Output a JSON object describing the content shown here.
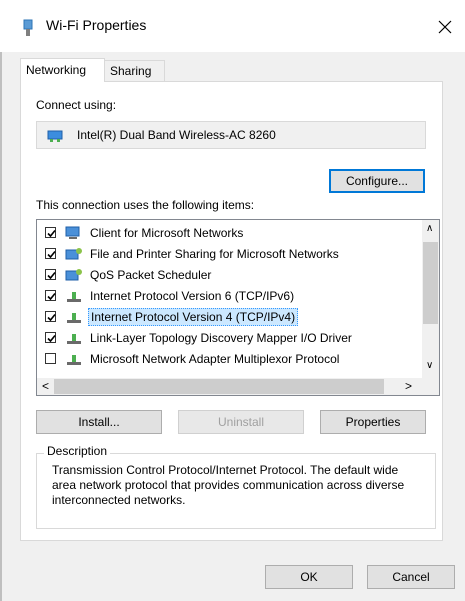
{
  "window": {
    "title": "Wi-Fi Properties",
    "close_glyph": "✕"
  },
  "tabs": [
    {
      "label": "Networking",
      "active": true
    },
    {
      "label": "Sharing",
      "active": false
    }
  ],
  "connect": {
    "label": "Connect using:",
    "adapter": "Intel(R) Dual Band Wireless-AC 8260",
    "configure_button": "Configure..."
  },
  "items_label": "This connection uses the following items:",
  "items": [
    {
      "label": "Client for Microsoft Networks",
      "checked": true,
      "icon": "network-client-icon"
    },
    {
      "label": "File and Printer Sharing for Microsoft Networks",
      "checked": true,
      "icon": "network-service-icon"
    },
    {
      "label": "QoS Packet Scheduler",
      "checked": true,
      "icon": "network-service-icon"
    },
    {
      "label": "Internet Protocol Version 6 (TCP/IPv6)",
      "checked": true,
      "icon": "protocol-icon"
    },
    {
      "label": "Internet Protocol Version 4 (TCP/IPv4)",
      "checked": true,
      "icon": "protocol-icon",
      "selected": true
    },
    {
      "label": "Link-Layer Topology Discovery Mapper I/O Driver",
      "checked": true,
      "icon": "protocol-icon"
    },
    {
      "label": "Microsoft Network Adapter Multiplexor Protocol",
      "checked": false,
      "icon": "protocol-icon"
    }
  ],
  "list_scroll": {
    "up": "∧",
    "down": "∨",
    "left": "<",
    "right": ">"
  },
  "buttons": {
    "install": "Install...",
    "uninstall": "Uninstall",
    "properties": "Properties",
    "ok": "OK",
    "cancel": "Cancel"
  },
  "description": {
    "title": "Description",
    "text": "Transmission Control Protocol/Internet Protocol. The default wide area network protocol that provides communication across diverse interconnected networks."
  },
  "colors": {
    "selection": "#cce8ff",
    "accent": "#0078d7"
  }
}
